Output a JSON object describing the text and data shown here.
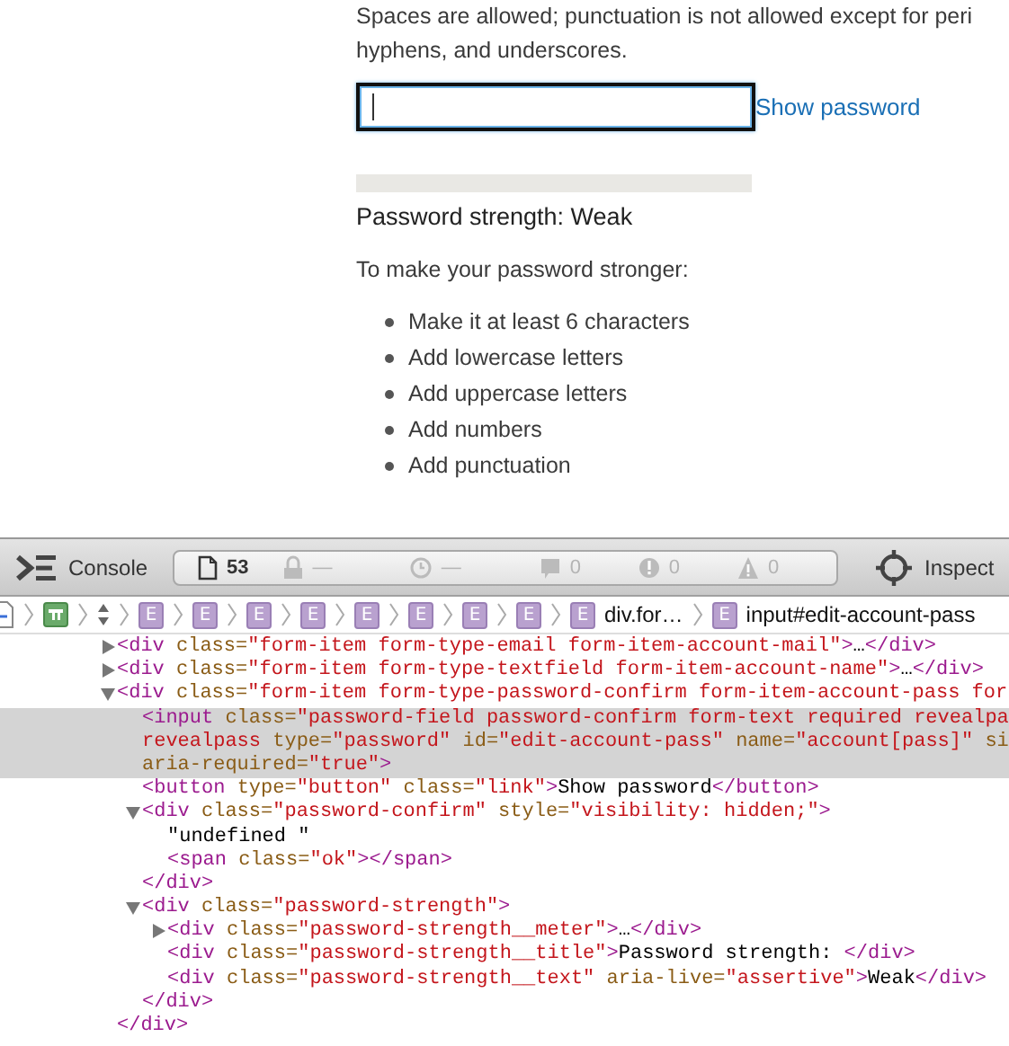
{
  "page": {
    "description": [
      "Spaces are allowed; punctuation is not allowed except for peri",
      "hyphens, and underscores."
    ],
    "password_field": {
      "focused": true
    },
    "show_password_link": "Show password",
    "strength": {
      "title": "Password strength: Weak"
    },
    "tips_intro": "To make your password stronger:",
    "tips": [
      "Make it at least 6 characters",
      "Add lowercase letters",
      "Add uppercase letters",
      "Add numbers",
      "Add punctuation"
    ]
  },
  "devtools": {
    "toolbar": {
      "console": "Console",
      "resources": "53",
      "network": "—",
      "timeline": "—",
      "logs": "0",
      "errors": "0",
      "warnings": "0",
      "inspect": "Inspect"
    },
    "breadcrumbs": [
      {
        "kind": "document"
      },
      {
        "kind": "frame"
      },
      {
        "kind": "stepper"
      },
      {
        "kind": "element",
        "badge": "E"
      },
      {
        "kind": "element",
        "badge": "E"
      },
      {
        "kind": "element",
        "badge": "E"
      },
      {
        "kind": "element",
        "badge": "E"
      },
      {
        "kind": "element",
        "badge": "E"
      },
      {
        "kind": "element",
        "badge": "E"
      },
      {
        "kind": "element",
        "badge": "E"
      },
      {
        "kind": "element",
        "badge": "E"
      },
      {
        "kind": "element",
        "badge": "E",
        "label": "div.for…"
      },
      {
        "kind": "element",
        "badge": "E",
        "label": "input#edit-account-pass"
      }
    ],
    "dom": [
      {
        "expanded": false,
        "selected": false,
        "lines": [
          [
            {
              "kind": "tag",
              "text": "<div"
            },
            {
              "kind": "attr",
              "text": " class="
            },
            {
              "kind": "value",
              "text": "\"form-item form-type-email form-item-account-mail\""
            },
            {
              "kind": "tag",
              "text": ">"
            },
            {
              "kind": "text",
              "text": "…"
            },
            {
              "kind": "tag",
              "text": "</div>"
            }
          ]
        ]
      },
      {
        "expanded": false,
        "selected": false,
        "lines": [
          [
            {
              "kind": "tag",
              "text": "<div"
            },
            {
              "kind": "attr",
              "text": " class="
            },
            {
              "kind": "value",
              "text": "\"form-item form-type-textfield form-item-account-name\""
            },
            {
              "kind": "tag",
              "text": ">"
            },
            {
              "kind": "text",
              "text": "…"
            },
            {
              "kind": "tag",
              "text": "</div>"
            }
          ]
        ]
      },
      {
        "expanded": true,
        "selected": false,
        "lines": [
          [
            {
              "kind": "tag",
              "text": "<div"
            },
            {
              "kind": "attr",
              "text": " class="
            },
            {
              "kind": "value",
              "text": "\"form-item form-type-password-confirm form-item-account-pass for"
            }
          ]
        ],
        "children": [
          {
            "selected": true,
            "lines": [
              [
                {
                  "kind": "tag",
                  "text": "<input"
                },
                {
                  "kind": "attr",
                  "text": " class="
                },
                {
                  "kind": "value",
                  "text": "\"password-field password-confirm form-text required revealpa"
                }
              ],
              [
                {
                  "kind": "value",
                  "text": "revealpass"
                },
                {
                  "kind": "attr",
                  "text": " type="
                },
                {
                  "kind": "value",
                  "text": "\"password\""
                },
                {
                  "kind": "attr",
                  "text": " id="
                },
                {
                  "kind": "value",
                  "text": "\"edit-account-pass\""
                },
                {
                  "kind": "attr",
                  "text": " name="
                },
                {
                  "kind": "value",
                  "text": "\"account[pass]\""
                },
                {
                  "kind": "attr",
                  "text": " si"
                }
              ],
              [
                {
                  "kind": "attr",
                  "text": "aria-required="
                },
                {
                  "kind": "value",
                  "text": "\"true\""
                },
                {
                  "kind": "tag",
                  "text": ">"
                }
              ]
            ]
          },
          {
            "selected": false,
            "lines": [
              [
                {
                  "kind": "tag",
                  "text": "<button"
                },
                {
                  "kind": "attr",
                  "text": " type="
                },
                {
                  "kind": "value",
                  "text": "\"button\""
                },
                {
                  "kind": "attr",
                  "text": " class="
                },
                {
                  "kind": "value",
                  "text": "\"link\""
                },
                {
                  "kind": "tag",
                  "text": ">"
                },
                {
                  "kind": "text",
                  "text": "Show password"
                },
                {
                  "kind": "tag",
                  "text": "</button>"
                }
              ]
            ]
          },
          {
            "expanded": true,
            "selected": false,
            "lines": [
              [
                {
                  "kind": "tag",
                  "text": "<div"
                },
                {
                  "kind": "attr",
                  "text": " class="
                },
                {
                  "kind": "value",
                  "text": "\"password-confirm\""
                },
                {
                  "kind": "attr",
                  "text": " style="
                },
                {
                  "kind": "value",
                  "text": "\"visibility: hidden;\""
                },
                {
                  "kind": "tag",
                  "text": ">"
                }
              ]
            ],
            "children": [
              {
                "selected": false,
                "lines": [
                  [
                    {
                      "kind": "text",
                      "text": "\"undefined \""
                    }
                  ]
                ]
              },
              {
                "selected": false,
                "lines": [
                  [
                    {
                      "kind": "tag",
                      "text": "<span"
                    },
                    {
                      "kind": "attr",
                      "text": " class="
                    },
                    {
                      "kind": "value",
                      "text": "\"ok\""
                    },
                    {
                      "kind": "tag",
                      "text": "></span>"
                    }
                  ]
                ]
              }
            ],
            "close": [
              {
                "kind": "tag",
                "text": "</div>"
              }
            ]
          },
          {
            "expanded": true,
            "selected": false,
            "lines": [
              [
                {
                  "kind": "tag",
                  "text": "<div"
                },
                {
                  "kind": "attr",
                  "text": " class="
                },
                {
                  "kind": "value",
                  "text": "\"password-strength\""
                },
                {
                  "kind": "tag",
                  "text": ">"
                }
              ]
            ],
            "children": [
              {
                "expanded": false,
                "selected": false,
                "lines": [
                  [
                    {
                      "kind": "tag",
                      "text": "<div"
                    },
                    {
                      "kind": "attr",
                      "text": " class="
                    },
                    {
                      "kind": "value",
                      "text": "\"password-strength__meter\""
                    },
                    {
                      "kind": "tag",
                      "text": ">"
                    },
                    {
                      "kind": "text",
                      "text": "…"
                    },
                    {
                      "kind": "tag",
                      "text": "</div>"
                    }
                  ]
                ]
              },
              {
                "selected": false,
                "lines": [
                  [
                    {
                      "kind": "tag",
                      "text": "<div"
                    },
                    {
                      "kind": "attr",
                      "text": " class="
                    },
                    {
                      "kind": "value",
                      "text": "\"password-strength__title\""
                    },
                    {
                      "kind": "tag",
                      "text": ">"
                    },
                    {
                      "kind": "text",
                      "text": "Password strength: "
                    },
                    {
                      "kind": "tag",
                      "text": "</div>"
                    }
                  ]
                ]
              },
              {
                "selected": false,
                "lines": [
                  [
                    {
                      "kind": "tag",
                      "text": "<div"
                    },
                    {
                      "kind": "attr",
                      "text": " class="
                    },
                    {
                      "kind": "value",
                      "text": "\"password-strength__text\""
                    },
                    {
                      "kind": "attr",
                      "text": " aria-live="
                    },
                    {
                      "kind": "value",
                      "text": "\"assertive\""
                    },
                    {
                      "kind": "tag",
                      "text": ">"
                    },
                    {
                      "kind": "text",
                      "text": "Weak"
                    },
                    {
                      "kind": "tag",
                      "text": "</div>"
                    }
                  ]
                ]
              }
            ],
            "close": [
              {
                "kind": "tag",
                "text": "</div>"
              }
            ]
          }
        ],
        "close": [
          {
            "kind": "tag",
            "text": "</div>"
          }
        ]
      }
    ]
  }
}
